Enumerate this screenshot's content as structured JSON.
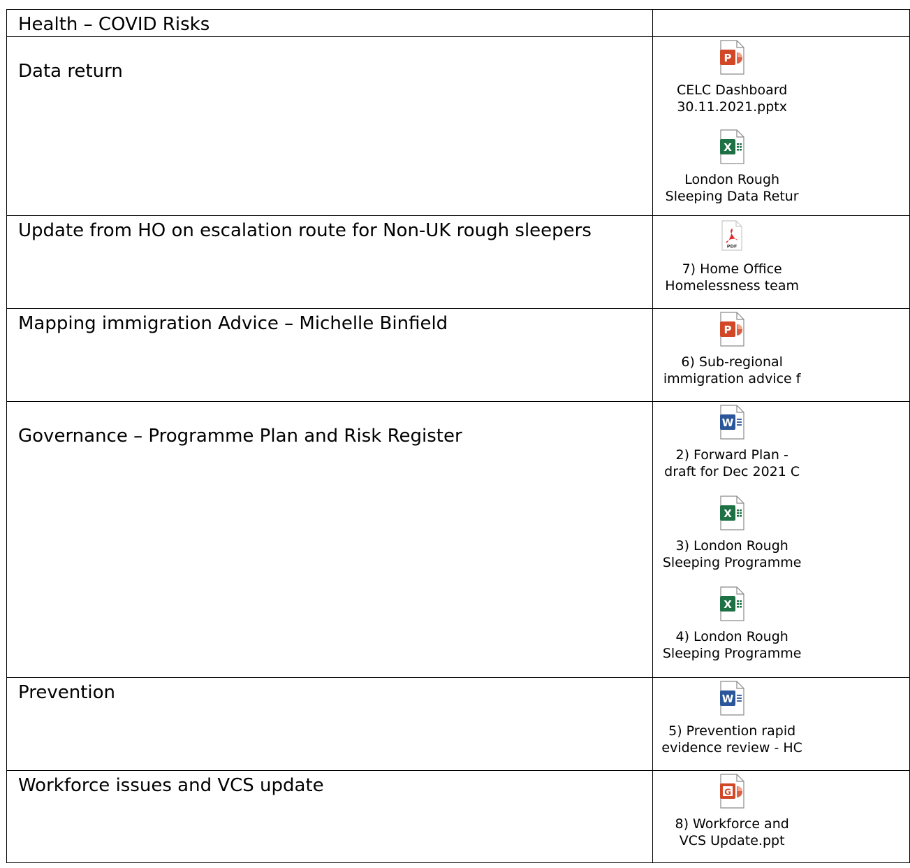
{
  "rows": [
    {
      "topic": "Health – COVID Risks",
      "files": []
    },
    {
      "topic": "Data return",
      "files": [
        {
          "type": "powerpoint",
          "icon": "powerpoint-file-icon",
          "line1": "CELC Dashboard",
          "line2": "30.11.2021.pptx"
        },
        {
          "type": "excel",
          "icon": "excel-file-icon",
          "line1": "London Rough",
          "line2": "Sleeping Data Retur"
        }
      ]
    },
    {
      "topic": "Update from HO on escalation route for Non-UK rough sleepers",
      "files": [
        {
          "type": "pdf",
          "icon": "pdf-file-icon",
          "line1": "7) Home Office",
          "line2": "Homelessness team"
        }
      ]
    },
    {
      "topic": "Mapping immigration Advice – Michelle Binfield",
      "files": [
        {
          "type": "powerpoint",
          "icon": "powerpoint-file-icon",
          "line1": "6) Sub-regional",
          "line2": "immigration advice f"
        }
      ]
    },
    {
      "topic": "Governance – Programme Plan and Risk Register",
      "files": [
        {
          "type": "word",
          "icon": "word-file-icon",
          "line1": "2) Forward Plan -",
          "line2": "draft for Dec 2021 C"
        },
        {
          "type": "excel",
          "icon": "excel-file-icon",
          "line1": "3) London Rough",
          "line2": "Sleeping Programme"
        },
        {
          "type": "excel",
          "icon": "excel-file-icon",
          "line1": "4) London Rough",
          "line2": "Sleeping Programme"
        }
      ]
    },
    {
      "topic": "Prevention",
      "files": [
        {
          "type": "word",
          "icon": "word-file-icon",
          "line1": "5) Prevention rapid",
          "line2": "evidence review - HC"
        }
      ]
    },
    {
      "topic": "Workforce issues and VCS update",
      "files": [
        {
          "type": "ppt-legacy",
          "icon": "powerpoint-legacy-file-icon",
          "line1": "8) Workforce and",
          "line2": "VCS Update.ppt"
        }
      ]
    }
  ],
  "colors": {
    "powerpoint": "#d24726",
    "excel": "#1e7145",
    "word": "#2b579a",
    "pdf": "#e5252a"
  }
}
